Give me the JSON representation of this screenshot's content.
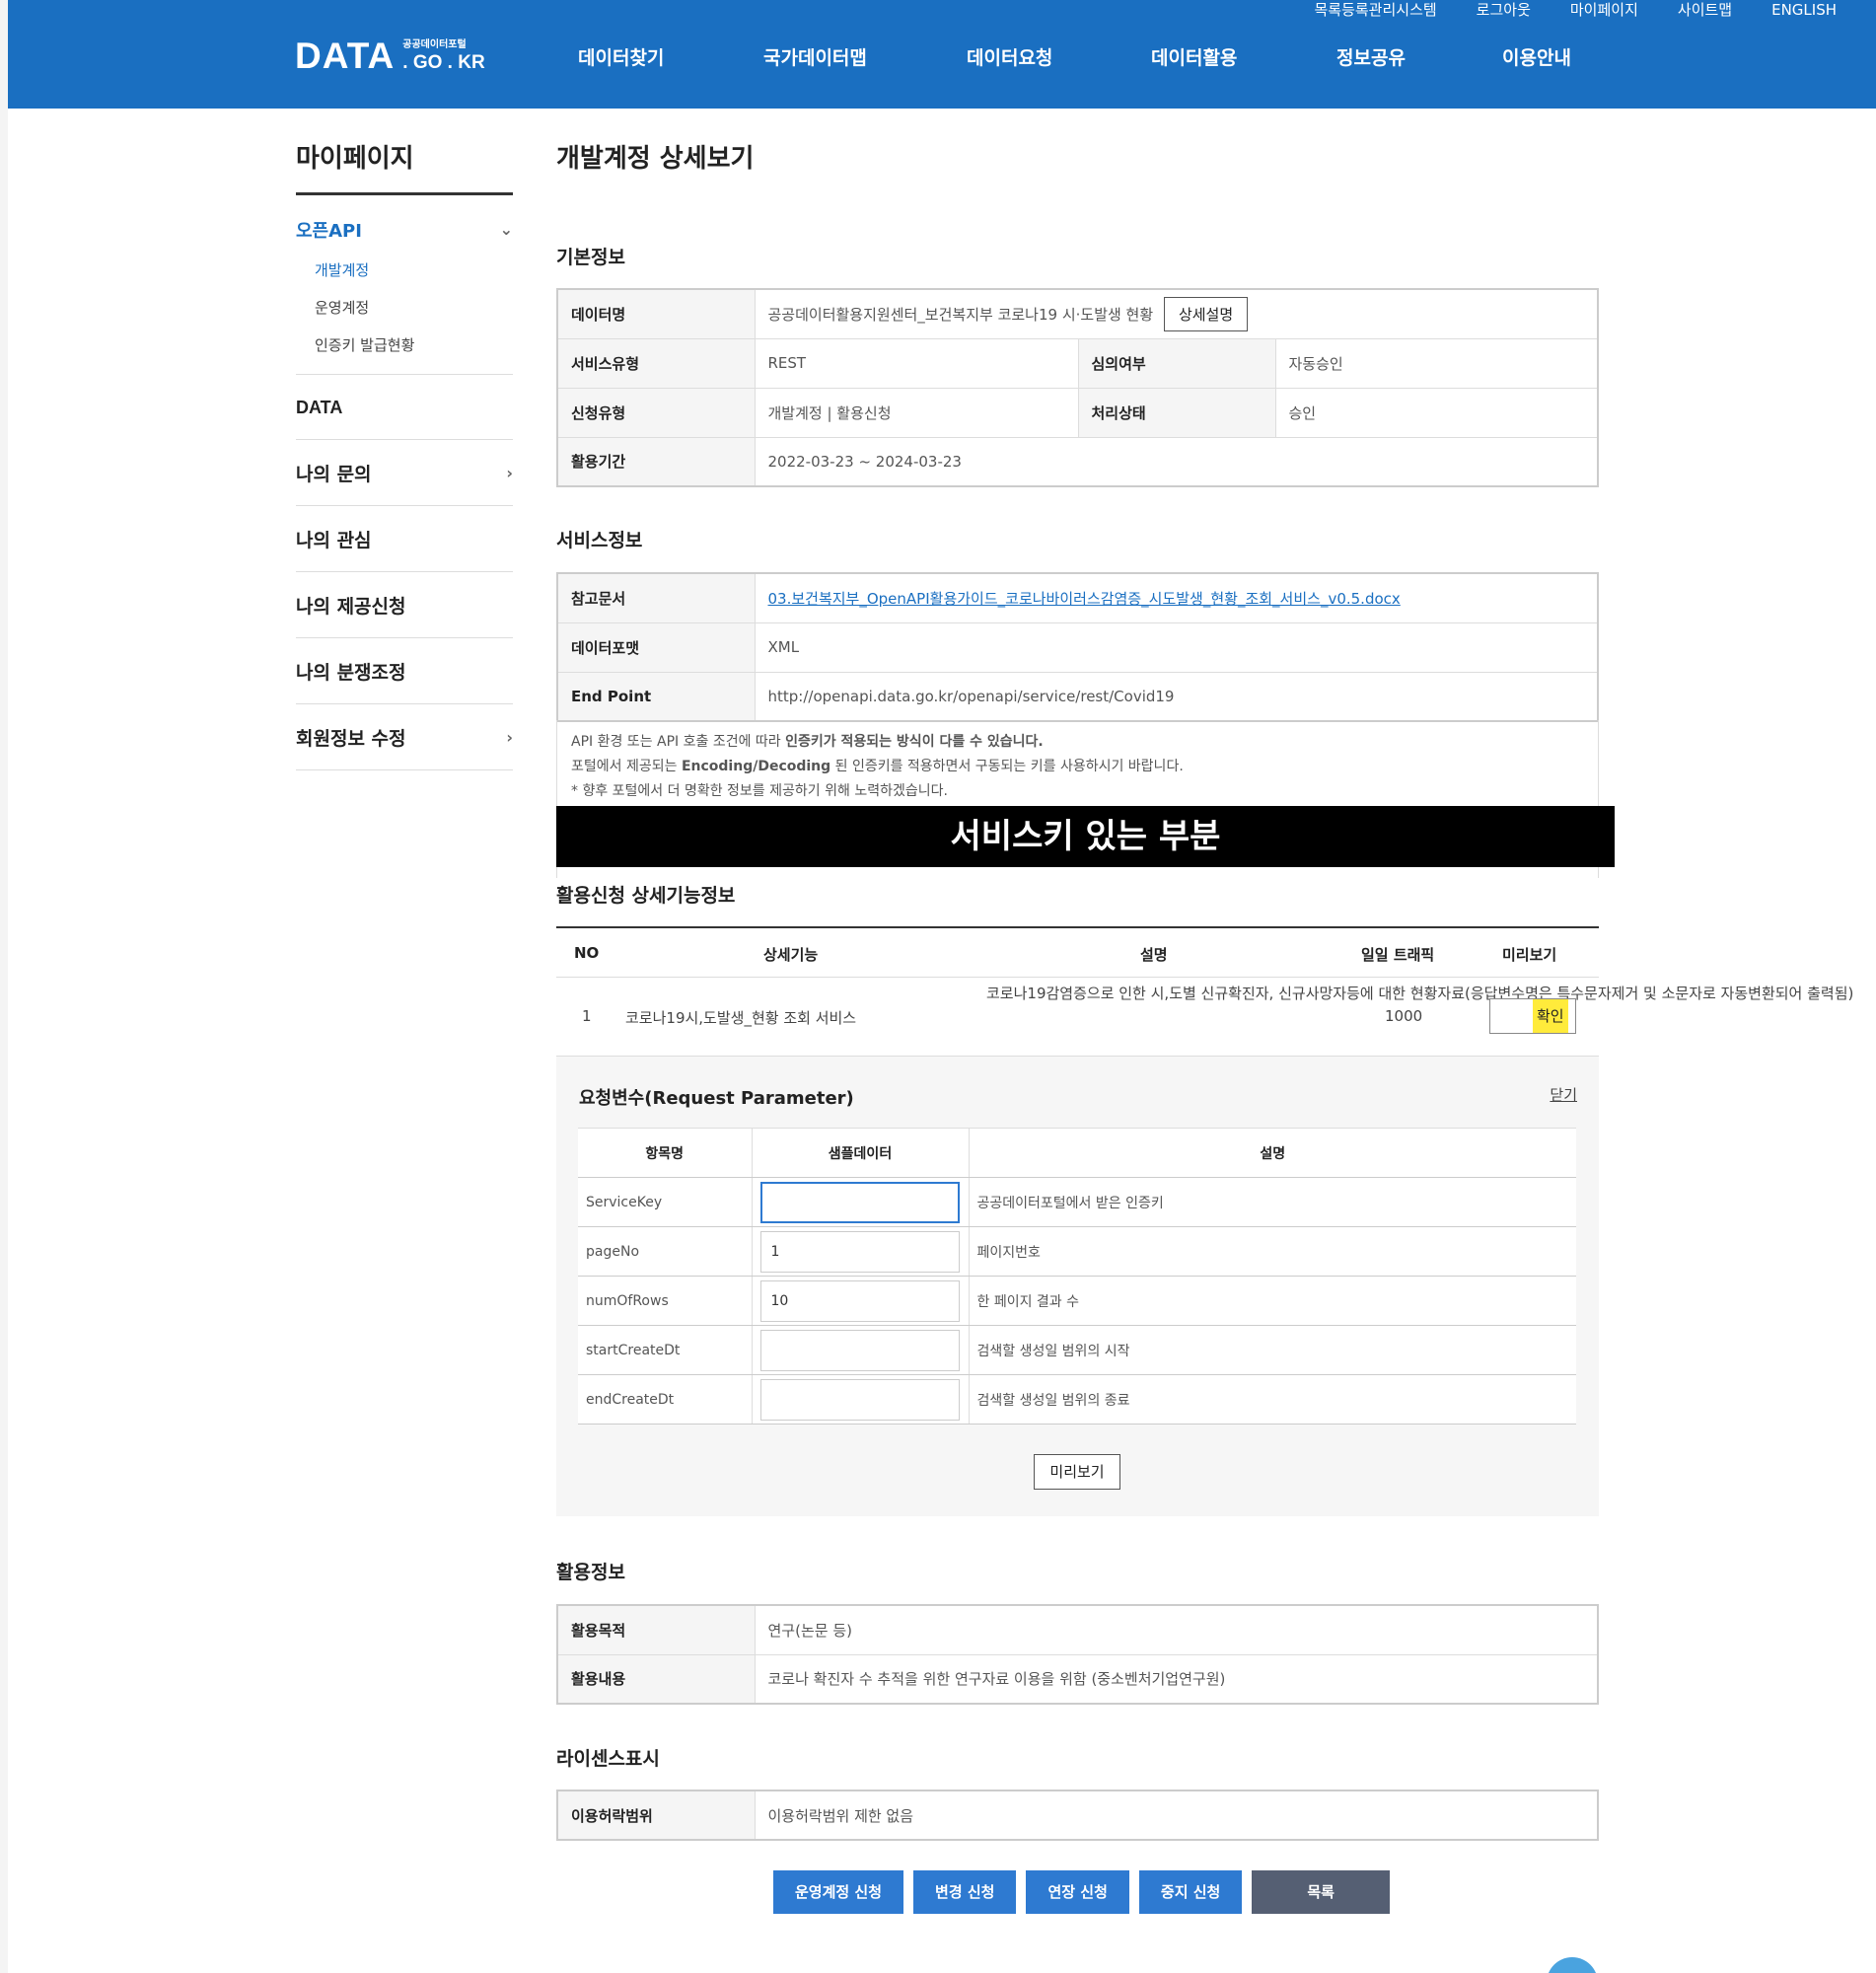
{
  "header": {
    "util_links": [
      "목록등록관리시스템",
      "로그아웃",
      "마이페이지",
      "사이트맵",
      "ENGLISH"
    ],
    "logo": {
      "main": "DATA",
      "sub_kr": "공공데이터포털",
      "sub_domain": ". GO . KR"
    },
    "nav": [
      "데이터찾기",
      "국가데이터맵",
      "데이터요청",
      "데이터활용",
      "정보공유",
      "이용안내"
    ]
  },
  "sidebar": {
    "title": "마이페이지",
    "openapi": "오픈API",
    "openapi_sub": [
      "개발계정",
      "운영계정",
      "인증키 발급현황"
    ],
    "data": "DATA",
    "items": [
      "나의 문의",
      "나의 관심",
      "나의 제공신청",
      "나의 분쟁조정",
      "회원정보 수정"
    ]
  },
  "page_title": "개발계정 상세보기",
  "basic": {
    "title": "기본정보",
    "data_name_label": "데이터명",
    "data_name": "공공데이터활용지원센터_보건복지부 코로나19 시·도발생 현황",
    "detail_button": "상세설명",
    "service_type_label": "서비스유형",
    "service_type": "REST",
    "review_label": "심의여부",
    "review": "자동승인",
    "apply_type_label": "신청유형",
    "apply_type": "개발계정 | 활용신청",
    "status_label": "처리상태",
    "status": "승인",
    "period_label": "활용기간",
    "period": "2022-03-23 ~ 2024-03-23"
  },
  "service": {
    "title": "서비스정보",
    "doc_label": "참고문서",
    "doc": "03.보건복지부_OpenAPI활용가이드_코로나바이러스감염증_시도발생_현황_조회_서비스_v0.5.docx",
    "format_label": "데이터포맷",
    "format": "XML",
    "endpoint_label": "End Point",
    "endpoint": "http://openapi.data.go.kr/openapi/service/rest/Covid19",
    "note1_a": "API 환경 또는 API 호출 조건에 따라 ",
    "note1_b": "인증키가 적용되는 방식이 다를 수 있습니다.",
    "note2_a": "포털에서 제공되는 ",
    "note2_b": "Encoding/Decoding",
    "note2_c": " 된 인증키를 적용하면서 구동되는 키를 사용하시기 바랍니다.",
    "note3": "* 향후 포털에서 더 명확한 정보를 제공하기 위해 노력하겠습니다."
  },
  "redaction": "서비스키 있는 부분",
  "functions": {
    "title": "활용신청 상세기능정보",
    "headers": [
      "NO",
      "상세기능",
      "설명",
      "일일 트래픽",
      "미리보기"
    ],
    "row": {
      "no": "1",
      "name": "코로나19시,도발생_현황 조회 서비스",
      "desc": "코로나19감염증으로 인한 시,도별 신규확진자, 신규사망자등에 대한 현황자료(응답변수명은 특수문자제거 및 소문자로 자동변환되어 출력됨)",
      "traffic": "1000",
      "button": "확인"
    }
  },
  "request": {
    "title": "요청변수(Request Parameter)",
    "close": "닫기",
    "headers": [
      "항목명",
      "샘플데이터",
      "설명"
    ],
    "rows": [
      {
        "name": "ServiceKey",
        "value": "",
        "desc": "공공데이터포털에서 받은 인증키"
      },
      {
        "name": "pageNo",
        "value": "1",
        "desc": "페이지번호"
      },
      {
        "name": "numOfRows",
        "value": "10",
        "desc": "한 페이지 결과 수"
      },
      {
        "name": "startCreateDt",
        "value": "",
        "desc": "검색할 생성일 범위의 시작"
      },
      {
        "name": "endCreateDt",
        "value": "",
        "desc": "검색할 생성일 범위의 종료"
      }
    ],
    "preview_button": "미리보기"
  },
  "usage": {
    "title": "활용정보",
    "purpose_label": "활용목적",
    "purpose": "연구(논문 등)",
    "content_label": "활용내용",
    "content": "코로나 확진자 수 추적을 위한 연구자료 이용을 위함 (중소벤처기업연구원)"
  },
  "license": {
    "title": "라이센스표시",
    "scope_label": "이용허락범위",
    "scope": "이용허락범위 제한 없음"
  },
  "actions": [
    "운영계정 신청",
    "변경 신청",
    "연장 신청",
    "중지 신청",
    "목록"
  ],
  "colors": {
    "brand": "#1a6fc1",
    "action": "#2e7ad1",
    "list_button": "#555f73",
    "highlight": "#ffeb3b"
  }
}
